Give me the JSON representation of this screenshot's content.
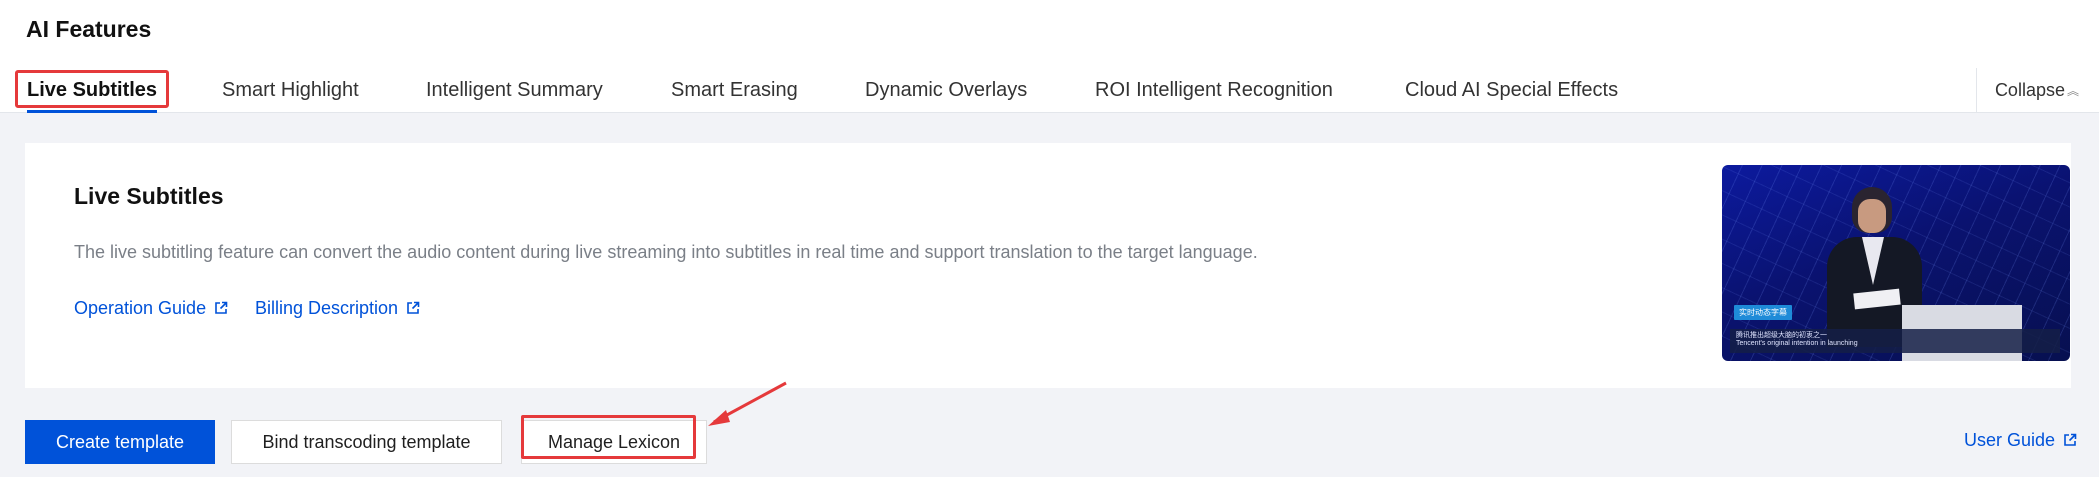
{
  "page": {
    "title": "AI Features"
  },
  "tabs": [
    {
      "label": "Live Subtitles",
      "active": true
    },
    {
      "label": "Smart Highlight",
      "active": false
    },
    {
      "label": "Intelligent Summary",
      "active": false
    },
    {
      "label": "Smart Erasing",
      "active": false
    },
    {
      "label": "Dynamic Overlays",
      "active": false
    },
    {
      "label": "ROI Intelligent Recognition",
      "active": false
    },
    {
      "label": "Cloud AI Special Effects",
      "active": false
    }
  ],
  "collapse": {
    "label": "Collapse",
    "icon": "chevron-up-icon"
  },
  "feature": {
    "title": "Live Subtitles",
    "description": "The live subtitling feature can convert the audio content during live streaming into subtitles in real time and support translation to the target language.",
    "links": [
      {
        "label": "Operation Guide",
        "icon": "external-link-icon"
      },
      {
        "label": "Billing Description",
        "icon": "external-link-icon"
      }
    ],
    "preview": {
      "subtitle_tag": "实时动态字幕",
      "subtitle_line_zh": "腾讯推出超级大脑的初衷之一",
      "subtitle_line_en": "Tencent's original intention in launching"
    }
  },
  "actions": {
    "create_template": "Create template",
    "bind_transcoding_template": "Bind transcoding template",
    "manage_lexicon": "Manage Lexicon",
    "user_guide": "User Guide"
  },
  "colors": {
    "accent": "#0052d9",
    "annotation_red": "#e5393b",
    "background": "#f2f3f7"
  }
}
